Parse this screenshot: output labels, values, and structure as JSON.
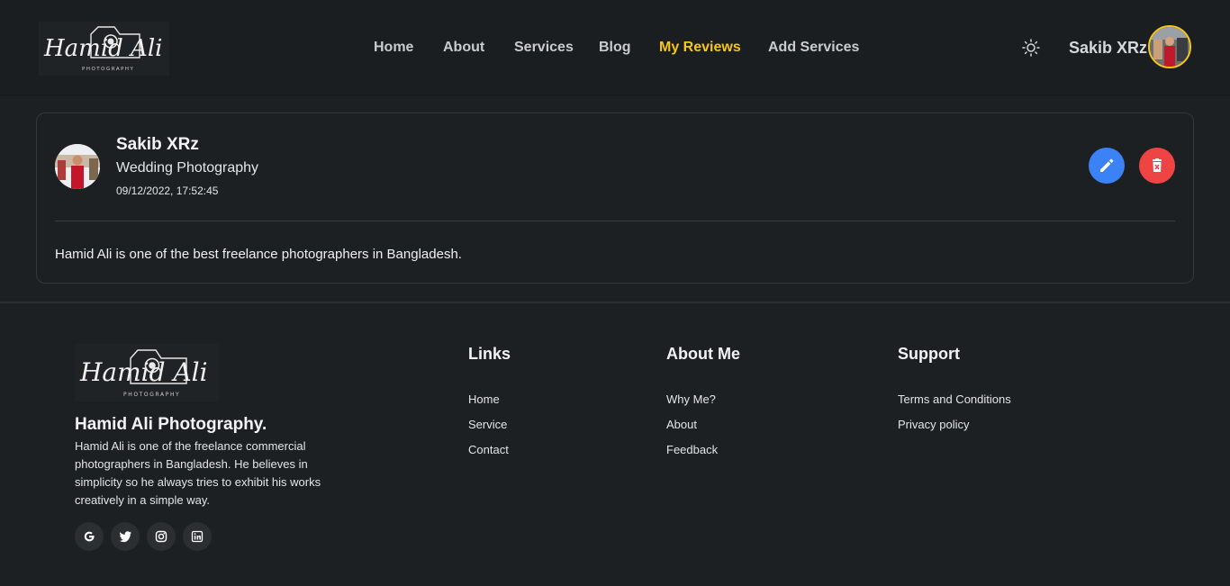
{
  "nav": {
    "logo_script": "Hamid Ali",
    "logo_sub": "PHOTOGRAPHY",
    "links": [
      "Home",
      "About",
      "Services",
      "Blog",
      "My Reviews",
      "Add Services"
    ],
    "active_link": "My Reviews",
    "user_name": "Sakib XRz",
    "accent": "#f5c518"
  },
  "review": {
    "name": "Sakib XRz",
    "service": "Wedding Photography",
    "date": "09/12/2022, 17:52:45",
    "text": "Hamid Ali is one of the best freelance photographers in Bangladesh.",
    "edit_color": "#3b82f6",
    "delete_color": "#ef4444"
  },
  "footer": {
    "logo_script": "Hamid Ali",
    "logo_sub": "PHOTOGRAPHY",
    "brand": "Hamid Ali Photography.",
    "description": "Hamid Ali is one of the freelance commercial photographers in Bangladesh. He believes in simplicity so he always tries to exhibit his works creatively in a simple way.",
    "socials": [
      "google-icon",
      "twitter-icon",
      "instagram-icon",
      "linkedin-icon"
    ],
    "links_title": "Links",
    "links": [
      "Home",
      "Service",
      "Contact"
    ],
    "about_title": "About Me",
    "about": [
      "Why Me?",
      "About",
      "Feedback"
    ],
    "support_title": "Support",
    "support": [
      "Terms and Conditions",
      "Privacy policy"
    ]
  }
}
